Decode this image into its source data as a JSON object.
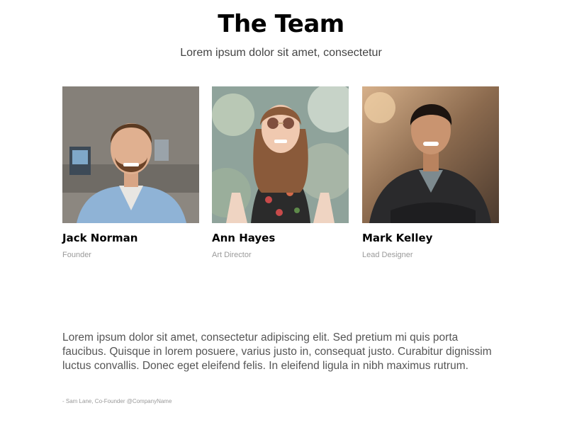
{
  "header": {
    "title": "The Team",
    "subtitle": "Lorem ipsum dolor sit amet, consectetur"
  },
  "team": [
    {
      "name": "Jack Norman",
      "role": "Founder"
    },
    {
      "name": "Ann Hayes",
      "role": "Art Director"
    },
    {
      "name": "Mark Kelley",
      "role": "Lead Designer"
    }
  ],
  "testimonial": {
    "quote": "Lorem ipsum dolor sit amet, consectetur adipiscing elit. Sed pretium mi quis porta faucibus. Quisque in lorem posuere, varius justo in, consequat justo. Curabitur dignissim luctus convallis. Donec eget eleifend felis. In eleifend ligula in nibh maximus rutrum.",
    "attribution": "- Sam Lane, Co-Founder @CompanyName"
  }
}
